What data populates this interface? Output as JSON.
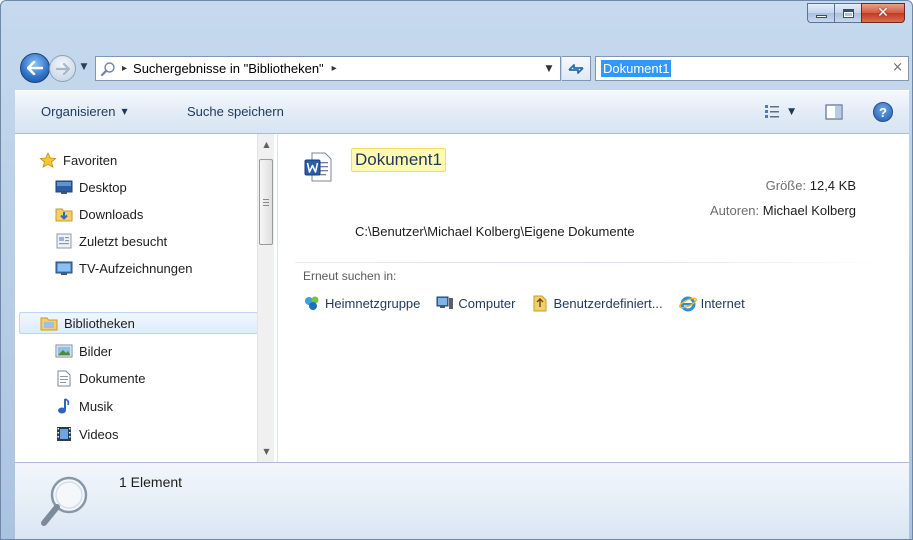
{
  "address": {
    "path_segment": "Suchergebnisse in \"Bibliotheken\"",
    "separator": "▸"
  },
  "search": {
    "query": "Dokument1",
    "clear": "×"
  },
  "toolbar": {
    "organize": "Organisieren",
    "save_search": "Suche speichern"
  },
  "nav": {
    "favorites": {
      "label": "Favoriten",
      "items": [
        {
          "label": "Desktop",
          "icon": "desktop-icon"
        },
        {
          "label": "Downloads",
          "icon": "downloads-folder-icon"
        },
        {
          "label": "Zuletzt besucht",
          "icon": "recent-places-icon"
        },
        {
          "label": "TV-Aufzeichnungen",
          "icon": "tv-recordings-icon"
        }
      ]
    },
    "libraries": {
      "label": "Bibliotheken",
      "items": [
        {
          "label": "Bilder",
          "icon": "pictures-icon"
        },
        {
          "label": "Dokumente",
          "icon": "documents-icon"
        },
        {
          "label": "Musik",
          "icon": "music-icon"
        },
        {
          "label": "Videos",
          "icon": "videos-icon"
        }
      ]
    }
  },
  "result": {
    "title": "Dokument1",
    "size_label": "Größe:",
    "size_value": "12,4 KB",
    "authors_label": "Autoren:",
    "authors_value": "Michael Kolberg",
    "path": "C:\\Benutzer\\Michael Kolberg\\Eigene Dokumente",
    "icon": "word-document-icon"
  },
  "research": {
    "label": "Erneut suchen in:",
    "links": [
      {
        "label": "Heimnetzgruppe",
        "icon": "homegroup-icon"
      },
      {
        "label": "Computer",
        "icon": "computer-icon"
      },
      {
        "label": "Benutzerdefiniert...",
        "icon": "custom-folder-icon"
      },
      {
        "label": "Internet",
        "icon": "internet-explorer-icon"
      }
    ]
  },
  "details": {
    "count": "1 Element"
  },
  "colors": {
    "accent": "#1e395b",
    "highlight": "#fff9b1",
    "selection": "#3297fd"
  }
}
